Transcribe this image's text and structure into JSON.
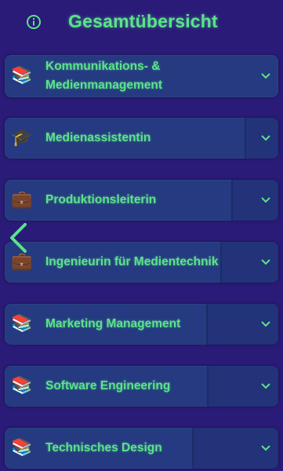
{
  "header": {
    "title": "Gesamtübersicht",
    "info_icon": "info-circle-icon"
  },
  "colors": {
    "background": "#2a1b78",
    "card": "#253a80",
    "accent": "#5be38a"
  },
  "items": [
    {
      "label_line1": "Kommunikations- &",
      "label_line2": "Medienmanagement",
      "icon": "books-icon",
      "emoji": "📚"
    },
    {
      "label": "Medienassistentin",
      "icon": "graduation-cap-icon",
      "emoji": "🎓"
    },
    {
      "label": "Produktionsleiterin",
      "icon": "briefcase-icon",
      "emoji": "💼"
    },
    {
      "label": "Ingenieurin für Medientechnik",
      "icon": "briefcase-icon",
      "emoji": "💼"
    },
    {
      "label": "Marketing Management",
      "icon": "books-icon",
      "emoji": "📚"
    },
    {
      "label": "Software Engineering",
      "icon": "books-icon",
      "emoji": "📚"
    },
    {
      "label": "Technisches Design",
      "icon": "books-icon",
      "emoji": "📚"
    }
  ],
  "nav": {
    "back_icon": "chevron-left-icon"
  }
}
